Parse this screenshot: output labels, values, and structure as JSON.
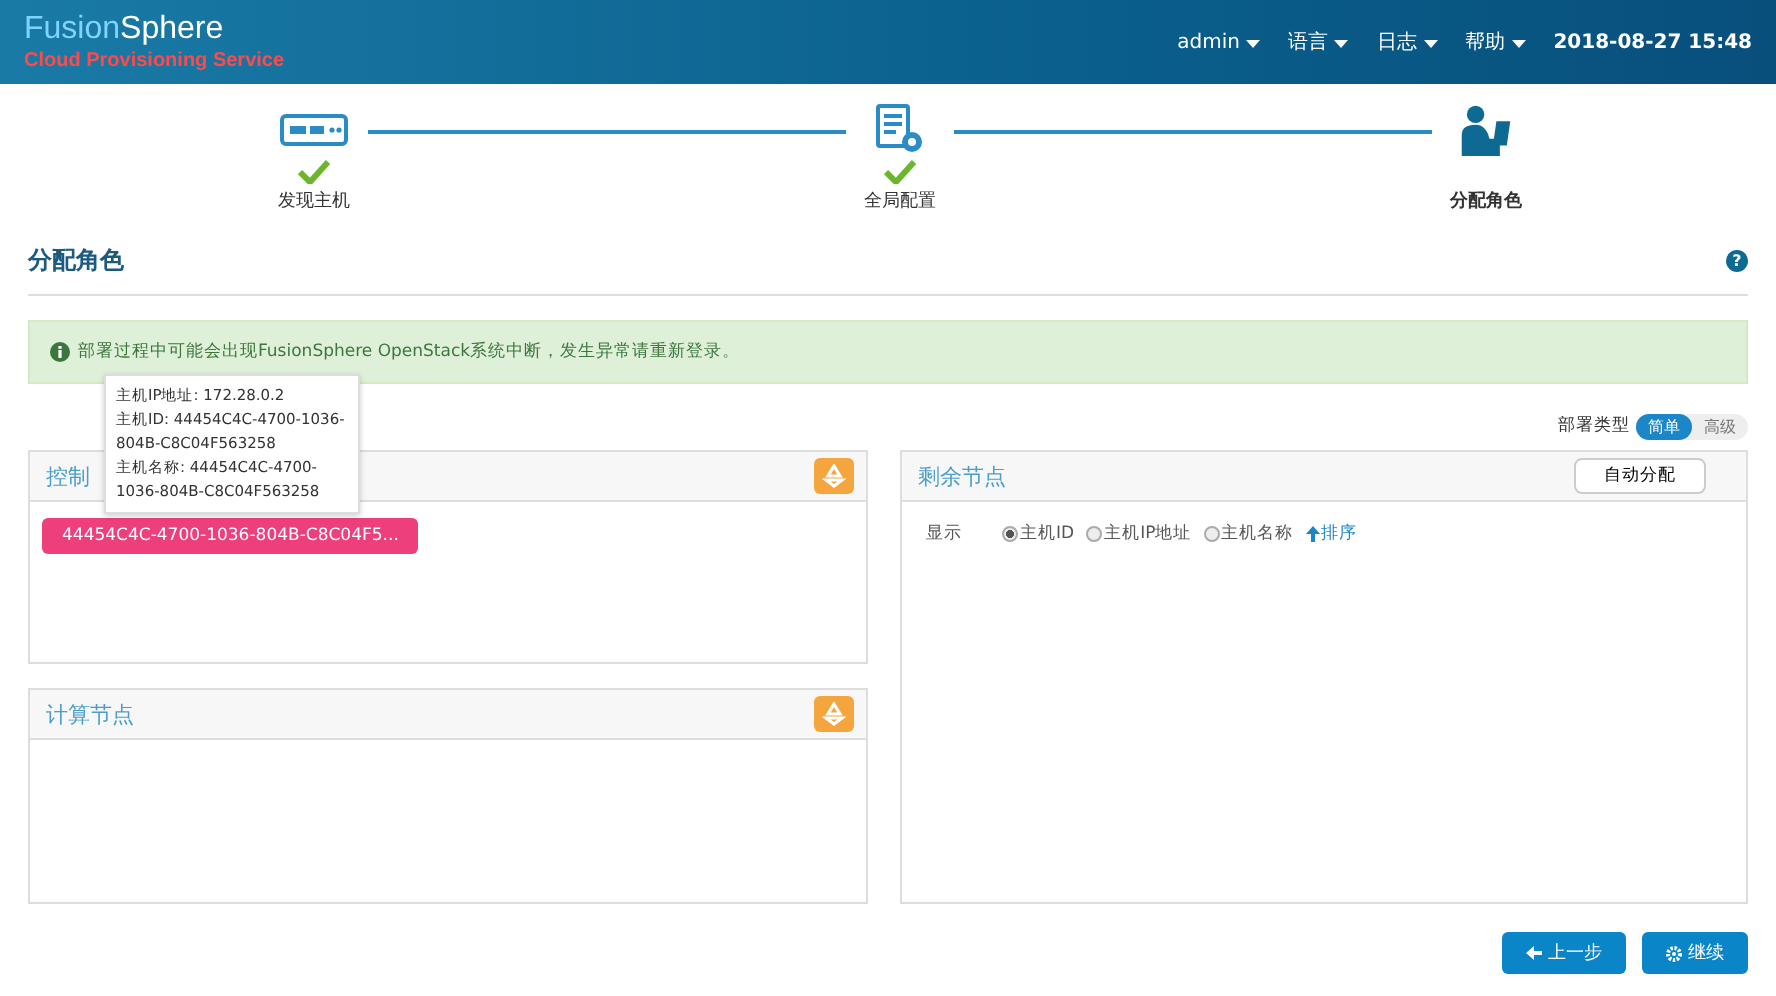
{
  "header": {
    "brand_light": "Fusion",
    "brand_bold": "Sphere",
    "subtitle": "Cloud Provisioning Service",
    "menus": [
      {
        "label": "admin"
      },
      {
        "label": "语言"
      },
      {
        "label": "日志"
      },
      {
        "label": "帮助"
      }
    ],
    "datetime": "2018-08-27 15:48"
  },
  "steps": [
    {
      "label": "发现主机",
      "kind": "server",
      "completed": true,
      "selected": false
    },
    {
      "label": "全局配置",
      "kind": "config",
      "completed": true,
      "selected": false
    },
    {
      "label": "分配角色",
      "kind": "user",
      "completed": false,
      "selected": true
    }
  ],
  "page_title": "分配角色",
  "help_icon": "?",
  "alert": "部署过程中可能会出现FusionSphere OpenStack系统中断，发生异常请重新登录。",
  "deploy_type": {
    "label": "部署类型",
    "options": [
      {
        "label": "简单",
        "selected": true
      },
      {
        "label": "高级",
        "selected": false
      }
    ]
  },
  "control_panel": {
    "title": "控制",
    "nodes": [
      "44454C4C-4700-1036-804B-C8C04F5..."
    ]
  },
  "tooltip": [
    "主机IP地址: 172.28.0.2",
    "主机ID: 44454C4C-4700-1036-804B-C8C04F563258",
    "主机名称: 44454C4C-4700-1036-804B-C8C04F563258"
  ],
  "compute_panel": {
    "title": "计算节点"
  },
  "remaining_panel": {
    "title": "剩余节点",
    "auto_button": "自动分配",
    "display_label": "显示",
    "options": [
      {
        "label": "主机ID",
        "selected": true
      },
      {
        "label": "主机IP地址",
        "selected": false
      },
      {
        "label": "主机名称",
        "selected": false
      }
    ],
    "sort_label": "排序"
  },
  "buttons": {
    "back": "上一步",
    "next": "继续"
  }
}
